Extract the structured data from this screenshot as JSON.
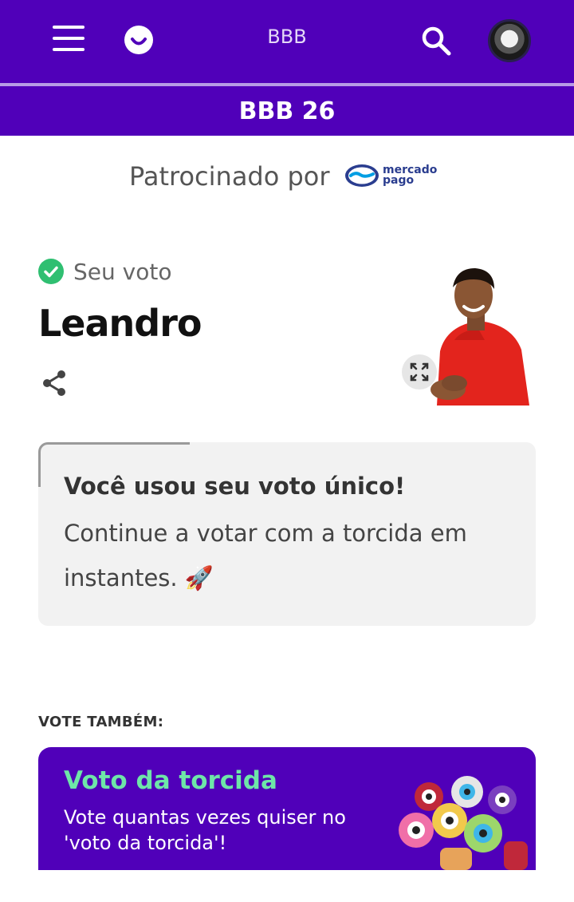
{
  "header": {
    "title": "BBB",
    "menu_icon": "hamburger-icon",
    "logo_icon": "globoplay-smile-icon",
    "search_icon": "search-icon",
    "avatar": "user-avatar",
    "subtitle": "BBB 26",
    "colors": {
      "primary": "#5000b9",
      "divider": "#b79be6"
    }
  },
  "sponsor": {
    "label": "Patrocinado por",
    "brand_line1": "mercado",
    "brand_line2": "pago"
  },
  "vote": {
    "status_label": "Seu voto",
    "status_icon": "check-circle-icon",
    "candidate_name": "Leandro",
    "share_icon": "share-icon",
    "expand_icon": "expand-icon"
  },
  "notice": {
    "title": "Você usou seu voto único!",
    "text": "Continue a votar com a torcida em instantes. 🚀"
  },
  "also": {
    "label": "VOTE TAMBÉM:",
    "card_title": "Voto da torcida",
    "card_text": "Vote quantas vezes quiser no 'voto da torcida'!",
    "colors": {
      "title": "#6ee6a8",
      "background": "#5000b9"
    }
  }
}
